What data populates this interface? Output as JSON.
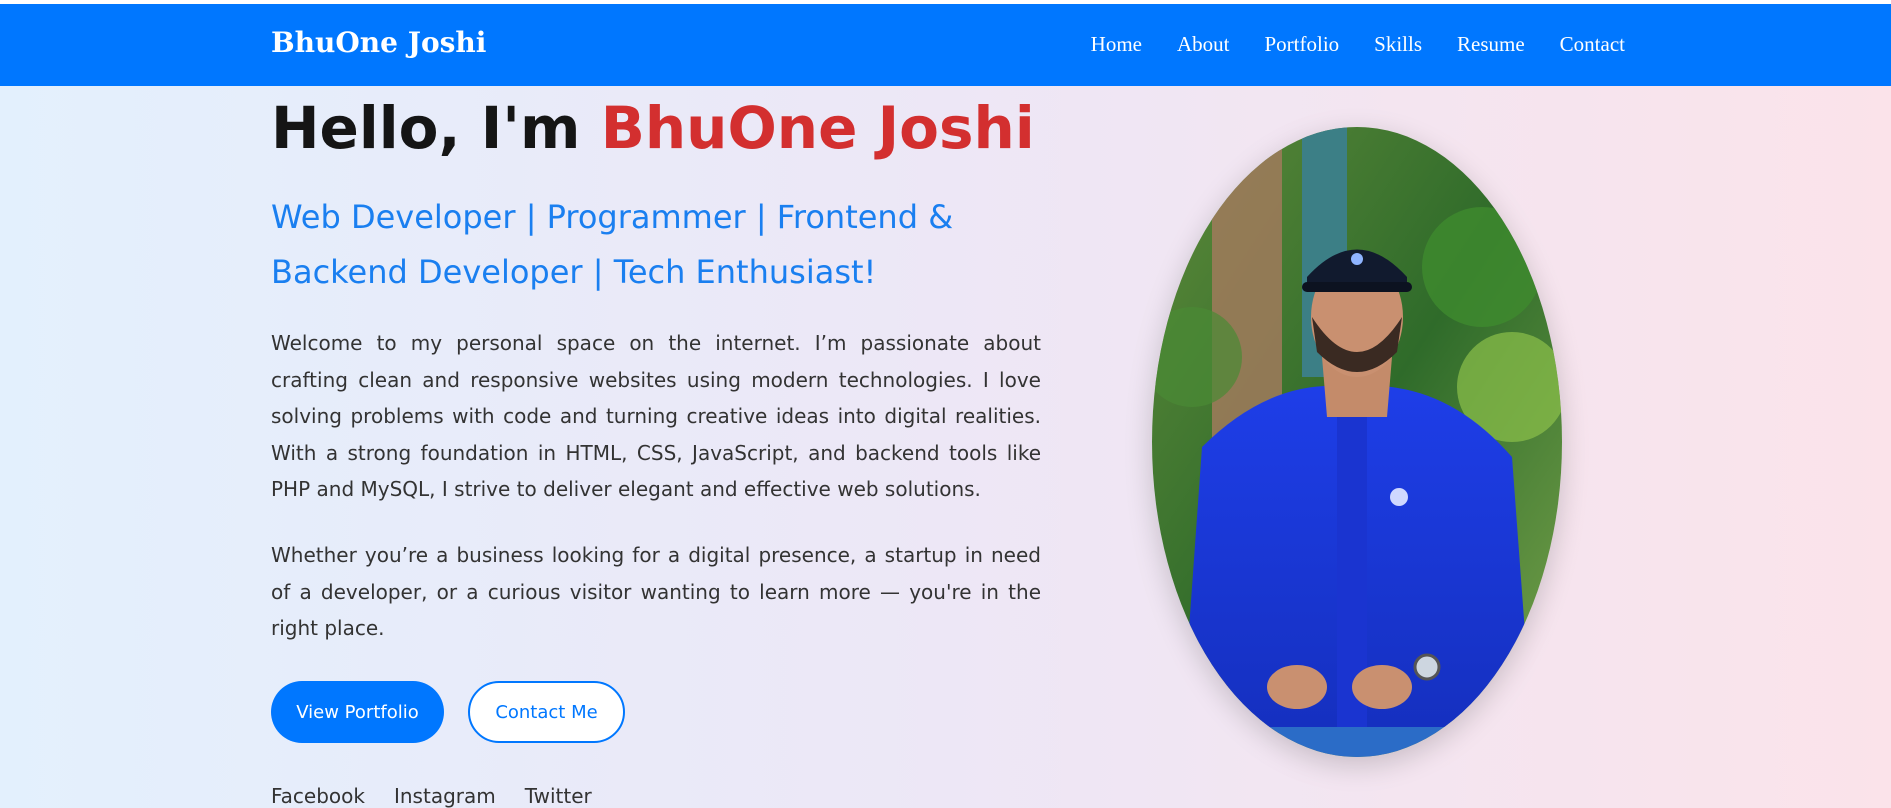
{
  "navbar": {
    "brand": "BhuOne Joshi",
    "links": [
      "Home",
      "About",
      "Portfolio",
      "Skills",
      "Resume",
      "Contact"
    ]
  },
  "hero": {
    "greeting": "Hello, I'm ",
    "name": "BhuOne Joshi",
    "subtitle": "Web Developer | Programmer | Frontend & Backend Developer | Tech Enthusiast!",
    "paragraph1": "Welcome to my personal space on the internet. I’m passionate about crafting clean and responsive websites using modern technologies. I love solving problems with code and turning creative ideas into digital realities. With a strong foundation in HTML, CSS, JavaScript, and backend tools like PHP and MySQL, I strive to deliver elegant and effective web solutions.",
    "paragraph2": "Whether you’re a business looking for a digital presence, a startup in need of a developer, or a curious visitor wanting to learn more — you're in the right place.",
    "primary_button": "View Portfolio",
    "secondary_button": "Contact Me"
  },
  "social": [
    "Facebook",
    "Instagram",
    "Twitter"
  ],
  "colors": {
    "primary": "#0077ff",
    "name_accent": "#d32f2f",
    "subtitle": "#1a7ff0",
    "text": "#333333"
  }
}
